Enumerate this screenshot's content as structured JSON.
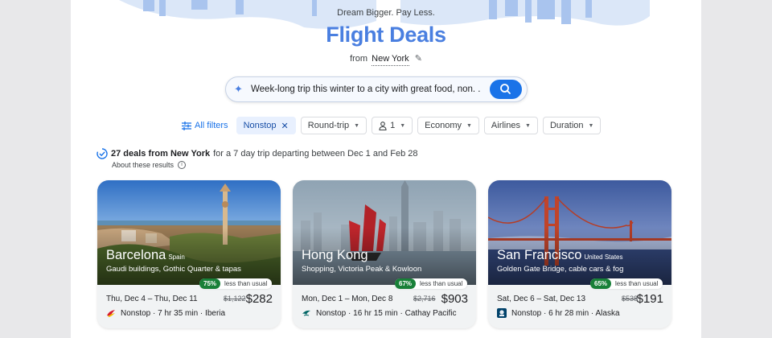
{
  "header": {
    "tagline": "Dream Bigger. Pay Less.",
    "title": "Flight Deals",
    "from_label": "from",
    "from_city": "New York"
  },
  "search": {
    "query": "Week-long trip this winter to a city with great food, non. ."
  },
  "filters": {
    "all_filters": "All filters",
    "chips": [
      {
        "label": "Nonstop",
        "active": true
      },
      {
        "label": "Round-trip"
      },
      {
        "label": "1"
      },
      {
        "label": "Economy"
      },
      {
        "label": "Airlines"
      },
      {
        "label": "Duration"
      }
    ]
  },
  "summary": {
    "bold": "27 deals from New York",
    "rest": "for a 7 day trip departing between Dec 1 and Feb 28",
    "about": "About these results"
  },
  "cards": [
    {
      "city": "Barcelona",
      "country": "Spain",
      "desc": "Gaudi buildings, Gothic Quarter & tapas",
      "pct": "75%",
      "badge_text": "less than usual",
      "dates": "Thu, Dec 4 – Thu, Dec 11",
      "old_price": "$1,122",
      "price": "$282",
      "flight": "Nonstop · 7 hr 35 min · Iberia"
    },
    {
      "city": "Hong Kong",
      "country": "",
      "desc": "Shopping, Victoria Peak & Kowloon",
      "pct": "67%",
      "badge_text": "less than usual",
      "dates": "Mon, Dec 1 – Mon, Dec 8",
      "old_price": "$2,716",
      "price": "$903",
      "flight": "Nonstop · 16 hr 15 min · Cathay Pacific"
    },
    {
      "city": "San Francisco",
      "country": "United States",
      "desc": "Golden Gate Bridge, cable cars & fog",
      "pct": "65%",
      "badge_text": "less than usual",
      "dates": "Sat, Dec 6 – Sat, Dec 13",
      "old_price": "$538",
      "price": "$191",
      "flight": "Nonstop · 6 hr 28 min · Alaska"
    }
  ],
  "colors": {
    "title_blue": "#4a7fe0",
    "accent": "#1a73e8",
    "deal_green": "#188038"
  },
  "icons": [
    "pencil-icon",
    "sparkle-icon",
    "search-icon",
    "filter-sliders-icon",
    "person-icon",
    "close-icon",
    "caret-down-icon",
    "badge-check-icon",
    "info-icon",
    "airline-logo-icon"
  ]
}
